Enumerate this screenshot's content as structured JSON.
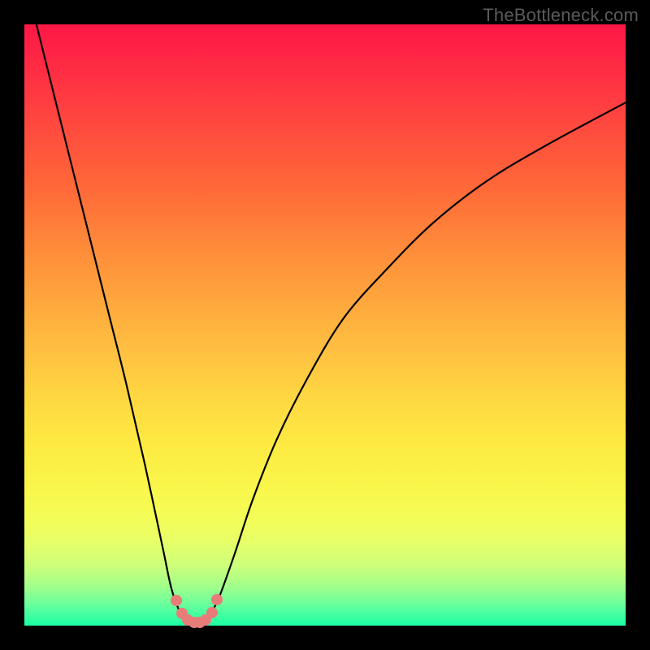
{
  "watermark": "TheBottleneck.com",
  "colors": {
    "page_bg": "#000000",
    "gradient_top": "#ff1846",
    "gradient_bottom": "#1cffa5",
    "curve_stroke": "#000000",
    "dot_fill": "#e77c79"
  },
  "chart_data": {
    "type": "line",
    "title": "",
    "xlabel": "",
    "ylabel": "",
    "xlim": [
      0,
      100
    ],
    "ylim": [
      0,
      100
    ],
    "annotations": [],
    "series": [
      {
        "name": "bottleneck-curve",
        "x": [
          2,
          5,
          8,
          11,
          14,
          17,
          20,
          23,
          24.5,
          26,
          27,
          28,
          29,
          30,
          31,
          32.5,
          35,
          38,
          42,
          47,
          53,
          60,
          68,
          77,
          87,
          100
        ],
        "y": [
          100,
          88,
          76,
          64,
          52,
          40,
          27,
          13,
          6,
          2,
          1,
          0.6,
          0.6,
          1,
          2,
          5,
          12,
          21,
          31,
          41,
          51,
          59,
          67,
          74,
          80,
          87
        ]
      }
    ],
    "highlight_points": {
      "name": "minimum-region-dots",
      "x": [
        25.3,
        26.2,
        27.2,
        28.2,
        29.2,
        30.2,
        31.2,
        32.0
      ],
      "y": [
        4.2,
        2.0,
        1.0,
        0.6,
        0.6,
        1.0,
        2.1,
        4.3
      ]
    }
  }
}
